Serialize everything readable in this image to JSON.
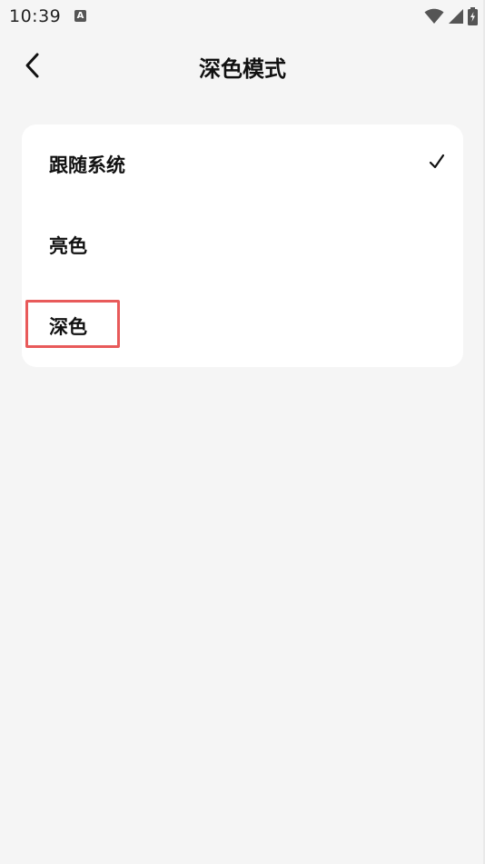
{
  "status_bar": {
    "time": "10:39",
    "a_badge": "A",
    "icons": [
      "wifi-icon",
      "signal-icon",
      "battery-charging-icon"
    ]
  },
  "header": {
    "title": "深色模式",
    "back_icon": "chevron-left-icon"
  },
  "options": [
    {
      "label": "跟随系统",
      "selected": true
    },
    {
      "label": "亮色",
      "selected": false
    },
    {
      "label": "深色",
      "selected": false
    }
  ],
  "colors": {
    "background": "#f5f5f5",
    "card": "#ffffff",
    "highlight": "#e85a5a"
  }
}
